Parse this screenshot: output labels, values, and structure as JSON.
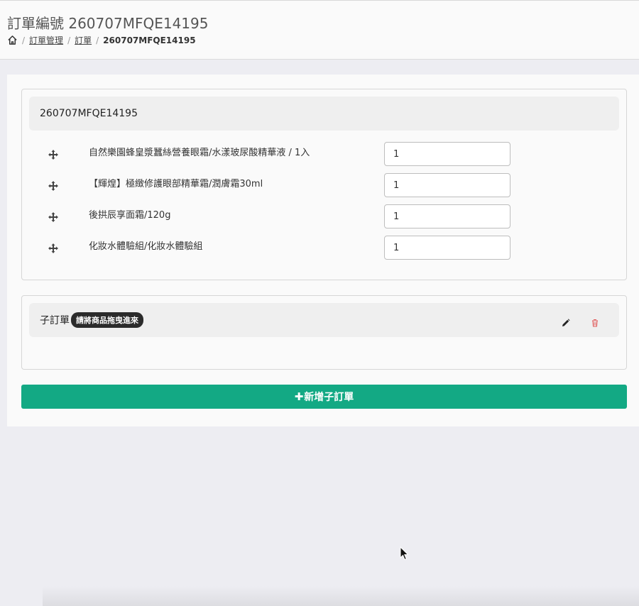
{
  "header": {
    "title": "訂單編號 260707MFQE14195",
    "breadcrumb": {
      "separator": "/",
      "items": [
        {
          "label": "訂單管理"
        },
        {
          "label": "訂單"
        }
      ],
      "current": "260707MFQE14195"
    }
  },
  "main_order": {
    "code": "260707MFQE14195",
    "items": [
      {
        "name": "自然樂園蜂皇漿蠶絲營養眼霜/水漾玻尿酸精華液 / 1入",
        "quantity": "1"
      },
      {
        "name": "【輝煌】極緻修護眼部精華霜/潤膚霜30ml",
        "quantity": "1"
      },
      {
        "name": "後拱辰享面霜/120g",
        "quantity": "1"
      },
      {
        "name": "化妝水體驗組/化妝水體驗組",
        "quantity": "1"
      }
    ]
  },
  "sub_order": {
    "title": "子訂單",
    "badge": "請將商品拖曳進來"
  },
  "actions": {
    "add_sub_order_icon": "✚",
    "add_sub_order_label": "新增子訂單"
  },
  "colors": {
    "primary_button": "#13a984",
    "delete_icon": "#e05a5a",
    "badge_bg": "#2b2b2b"
  },
  "icons": [
    "home-icon",
    "move-icon",
    "pencil-icon",
    "trash-icon",
    "mouse-cursor-icon"
  ]
}
